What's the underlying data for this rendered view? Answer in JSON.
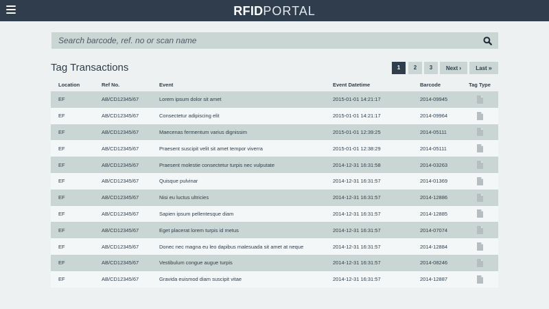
{
  "header": {
    "brand_bold": "RFID",
    "brand_light": "PORTAL",
    "menu_icon": "hamburger-menu-icon"
  },
  "search": {
    "placeholder": "Search barcode, ref. no or scan name",
    "value": "",
    "icon": "search-icon"
  },
  "main": {
    "title": "Tag Transactions"
  },
  "pagination": {
    "pages": [
      "1",
      "2",
      "3"
    ],
    "active_page": "1",
    "next_label": "Next",
    "last_label": "Last",
    "next_icon": "chevron-right-icon",
    "last_icon": "double-chevron-right-icon"
  },
  "table": {
    "columns": [
      "Location",
      "Ref No.",
      "Event",
      "Event Datetime",
      "Barcode",
      "Tag Type"
    ],
    "tag_type_icon": "document-icon",
    "rows": [
      {
        "location": "EF",
        "ref": "AB/CD12345/67",
        "event": "Lorem ipsum dolor sit amet",
        "datetime": "2015-01-01 14:21:17",
        "barcode": "2014-09945"
      },
      {
        "location": "EF",
        "ref": "AB/CD12345/67",
        "event": "Consectetur adipiscing elit",
        "datetime": "2015-01-01 14:21:17",
        "barcode": "2014-09964"
      },
      {
        "location": "EF",
        "ref": "AB/CD12345/67",
        "event": "Maecenas fermentum varius dignissim",
        "datetime": "2015-01-01 12:39:25",
        "barcode": "2014-05111"
      },
      {
        "location": "EF",
        "ref": "AB/CD12345/67",
        "event": "Praesent suscipit velit sit amet tempor viverra",
        "datetime": "2015-01-01 12:38:29",
        "barcode": "2014-05111"
      },
      {
        "location": "EF",
        "ref": "AB/CD12345/67",
        "event": "Praesent molestie consectetur turpis nec vulputate",
        "datetime": "2014-12-31 16:31:58",
        "barcode": "2014-03263"
      },
      {
        "location": "EF",
        "ref": "AB/CD12345/67",
        "event": "Quisque pulvinar",
        "datetime": "2014-12-31 16:31:57",
        "barcode": "2014-01369"
      },
      {
        "location": "EF",
        "ref": "AB/CD12345/67",
        "event": "Nisi eu luctus ultricies",
        "datetime": "2014-12-31 16:31:57",
        "barcode": "2014-12886"
      },
      {
        "location": "EF",
        "ref": "AB/CD12345/67",
        "event": "Sapien ipsum pellentesque diam",
        "datetime": "2014-12-31 16:31:57",
        "barcode": "2014-12885"
      },
      {
        "location": "EF",
        "ref": "AB/CD12345/67",
        "event": "Eget placerat lorem turpis id metus",
        "datetime": "2014-12-31 16:31:57",
        "barcode": "2014-07074"
      },
      {
        "location": "EF",
        "ref": "AB/CD12345/67",
        "event": "Donec nec magna eu leo dapibus malesuada sit amet at neque",
        "datetime": "2014-12-31 16:31:57",
        "barcode": "2014-12884"
      },
      {
        "location": "EF",
        "ref": "AB/CD12345/67",
        "event": "Vestibulum congue augue turpis",
        "datetime": "2014-12-31 16:31:57",
        "barcode": "2014-08246"
      },
      {
        "location": "EF",
        "ref": "AB/CD12345/67",
        "event": "Gravida euismod diam suscipit vitae",
        "datetime": "2014-12-31 16:31:57",
        "barcode": "2014-12887"
      }
    ]
  },
  "colors": {
    "topbar": "#2f3d4d",
    "page_bg": "#edf1f1",
    "row_stripe": "#c9d6d4",
    "row_plain": "#f4f7f7",
    "text": "#2f3d4a",
    "icon_gray": "#b7bec2"
  }
}
